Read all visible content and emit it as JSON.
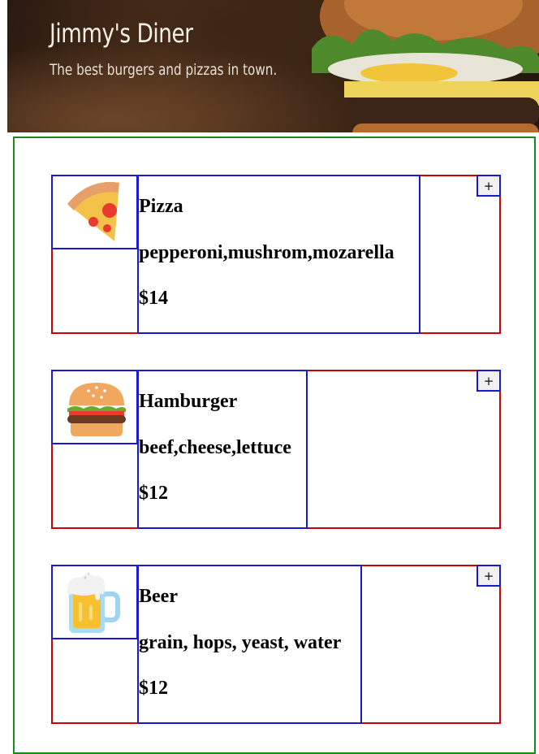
{
  "header": {
    "title": "Jimmy's Diner",
    "tagline": "The best burgers and pizzas in town."
  },
  "menu": {
    "items": [
      {
        "name": "Pizza",
        "ingredients": "pepperoni,mushrom,mozarella",
        "price": "$14",
        "icon": "pizza-slice-icon",
        "add_label": "+"
      },
      {
        "name": "Hamburger",
        "ingredients": "beef,cheese,lettuce",
        "price": "$12",
        "icon": "hamburger-icon",
        "add_label": "+"
      },
      {
        "name": "Beer",
        "ingredients": "grain, hops, yeast, water",
        "price": "$12",
        "icon": "beer-mug-icon",
        "add_label": "+"
      }
    ]
  },
  "colors": {
    "outer_border": "#1a8a1a",
    "item_border": "#d10000",
    "inner_border": "#1a1acc"
  }
}
